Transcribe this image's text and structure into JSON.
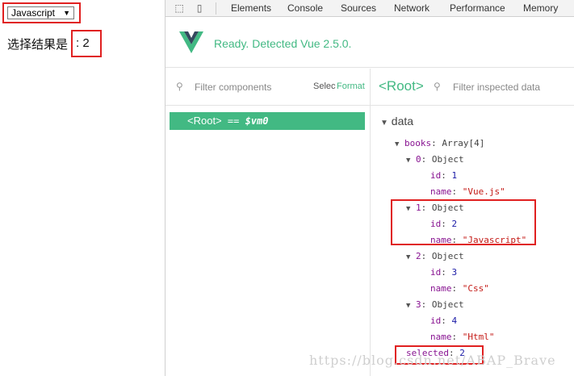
{
  "app": {
    "select_value": "Javascript",
    "result_label": "选择结果是",
    "result_value": ": 2"
  },
  "devtools": {
    "tabs": [
      "Elements",
      "Console",
      "Sources",
      "Network",
      "Performance",
      "Memory"
    ],
    "ready_text": "Ready. Detected Vue 2.5.0.",
    "components_placeholder": "Filter components",
    "select_label": "Selec",
    "format_label": "Format",
    "root_label": "<Root>",
    "inspector_placeholder": "Filter inspected data",
    "root_row": {
      "tag": "<Root>",
      "eq": "==",
      "vm": "$vm0"
    }
  },
  "tree": {
    "section": "data",
    "books_key": "books",
    "books_type": "Array[4]",
    "items": [
      {
        "index": "0",
        "type": "Object",
        "id": "1",
        "name": "\"Vue.js\""
      },
      {
        "index": "1",
        "type": "Object",
        "id": "2",
        "name": "\"Javascript\""
      },
      {
        "index": "2",
        "type": "Object",
        "id": "3",
        "name": "\"Css\""
      },
      {
        "index": "3",
        "type": "Object",
        "id": "4",
        "name": "\"Html\""
      }
    ],
    "id_key": "id",
    "name_key": "name",
    "selected_key": "selected",
    "selected_value": "2"
  },
  "watermark": "https://blog.csdn.net/ABAP_Brave",
  "colors": {
    "vue_green": "#42b983",
    "highlight_red": "#e02020"
  }
}
